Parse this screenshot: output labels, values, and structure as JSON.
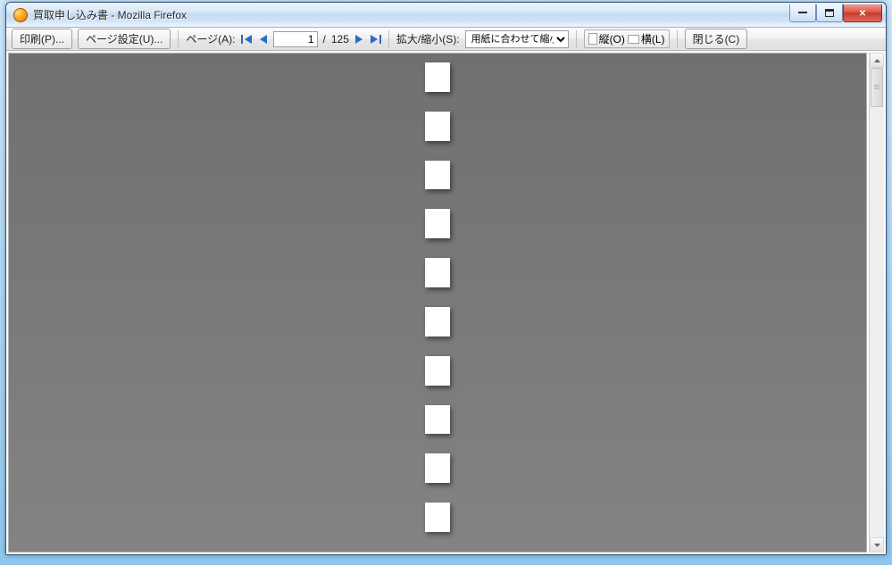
{
  "window": {
    "title": "買取申し込み書 - Mozilla Firefox"
  },
  "toolbar": {
    "print_label": "印刷(P)...",
    "page_setup_label": "ページ設定(U)...",
    "page_label": "ページ(A):",
    "current_page": "1",
    "page_sep": "/",
    "total_pages": "125",
    "zoom_label": "拡大/縮小(S):",
    "zoom_value": "用紙に合わせて縮小",
    "orientation": {
      "portrait_label": "縦(O)",
      "landscape_label": "横(L)"
    },
    "close_label": "閉じる(C)"
  }
}
